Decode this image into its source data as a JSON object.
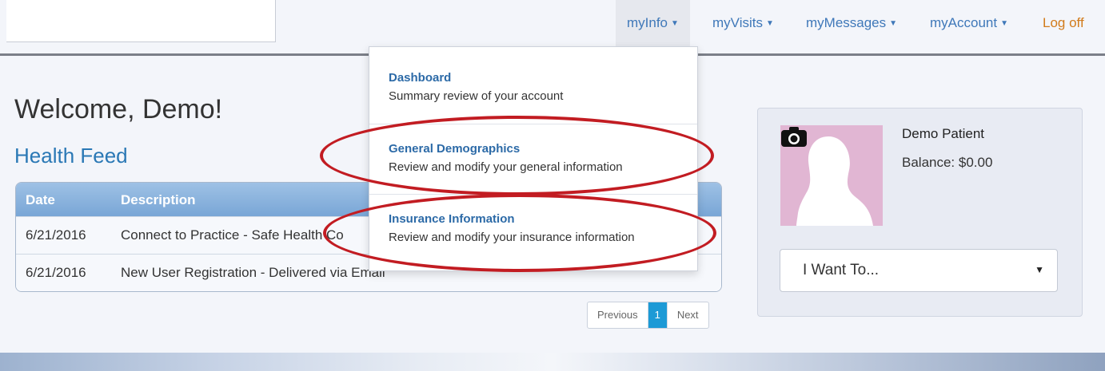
{
  "nav": {
    "myinfo": "myInfo",
    "myvisits": "myVisits",
    "mymessages": "myMessages",
    "myaccount": "myAccount",
    "logoff": "Log off"
  },
  "main": {
    "welcome": "Welcome, Demo!",
    "feed_title": "Health Feed",
    "columns": {
      "date": "Date",
      "description": "Description"
    },
    "rows": [
      {
        "date": "6/21/2016",
        "description": "Connect to Practice - Safe Health Co"
      },
      {
        "date": "6/21/2016",
        "description": "New User Registration - Delivered via Email"
      }
    ],
    "pagination": {
      "previous": "Previous",
      "current": "1",
      "next": "Next"
    }
  },
  "dropdown": {
    "items": [
      {
        "title": "Dashboard",
        "desc": "Summary review of your account"
      },
      {
        "title": "General Demographics",
        "desc": "Review and modify your general information"
      },
      {
        "title": "Insurance Information",
        "desc": "Review and modify your insurance information"
      }
    ]
  },
  "profile": {
    "name": "Demo Patient",
    "balance": "Balance: $0.00",
    "select_label": "I Want To..."
  },
  "colors": {
    "accent": "#3f78b9",
    "logoff": "#d27b1b",
    "highlight_oval": "#c21c22",
    "avatar_bg": "#e1b6d3"
  },
  "icons": {
    "caret": "chevron-down-icon",
    "camera": "camera-icon",
    "avatar": "avatar-silhouette"
  }
}
